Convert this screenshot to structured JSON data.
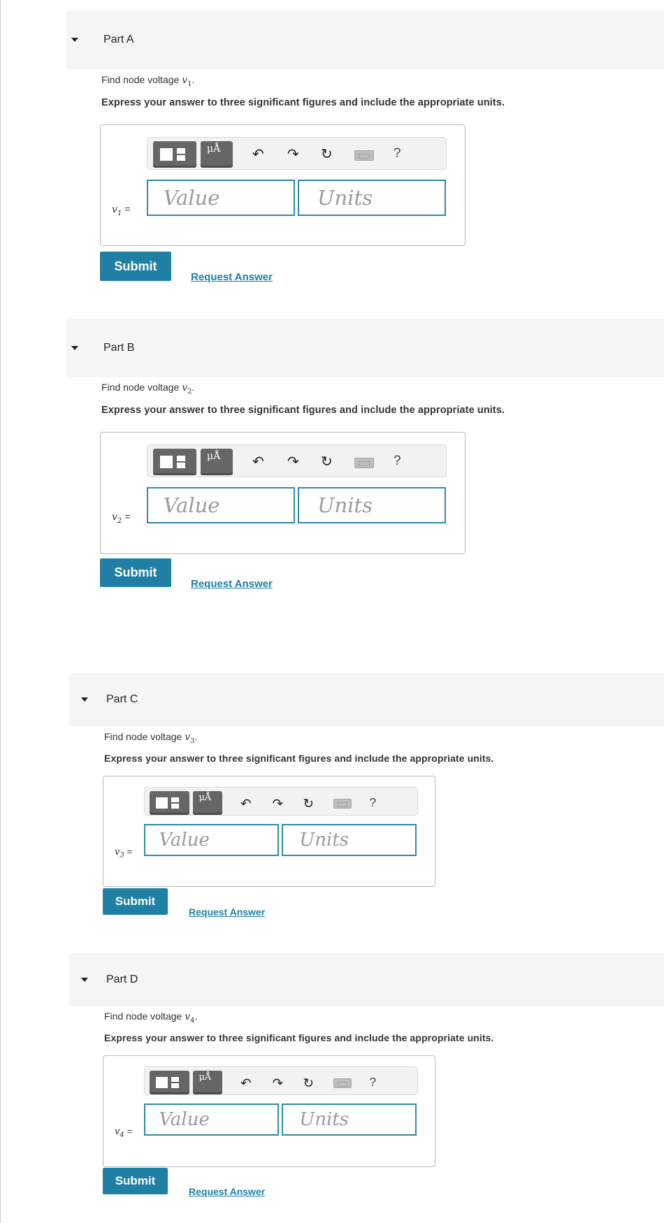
{
  "parts": [
    {
      "title": "Part A",
      "prompt_text": "Find node voltage ",
      "var": "v",
      "sub": "1",
      "instruction": "Express your answer to three significant figures and include the appropriate units.",
      "equals": "=",
      "value_placeholder": "Value",
      "units_placeholder": "Units",
      "submit_label": "Submit",
      "request_label": "Request Answer",
      "unit_glyph": "μÅ",
      "help": "?"
    },
    {
      "title": "Part B",
      "prompt_text": "Find node voltage ",
      "var": "v",
      "sub": "2",
      "instruction": "Express your answer to three significant figures and include the appropriate units.",
      "equals": "=",
      "value_placeholder": "Value",
      "units_placeholder": "Units",
      "submit_label": "Submit",
      "request_label": "Request Answer",
      "unit_glyph": "μÅ",
      "help": "?"
    },
    {
      "title": "Part C",
      "prompt_text": "Find node voltage ",
      "var": "v",
      "sub": "3",
      "instruction": "Express your answer to three significant figures and include the appropriate units.",
      "equals": "=",
      "value_placeholder": "Value",
      "units_placeholder": "Units",
      "submit_label": "Submit",
      "request_label": "Request Answer",
      "unit_glyph": "μÅ",
      "help": "?"
    },
    {
      "title": "Part D",
      "prompt_text": "Find node voltage ",
      "var": "v",
      "sub": "4",
      "instruction": "Express your answer to three significant figures and include the appropriate units.",
      "equals": "=",
      "value_placeholder": "Value",
      "units_placeholder": "Units",
      "submit_label": "Submit",
      "request_label": "Request Answer",
      "unit_glyph": "μÅ",
      "help": "?"
    }
  ],
  "icons": {
    "undo": "undo-icon",
    "redo": "redo-icon",
    "reset": "reset-icon",
    "keyboard": "keyboard-icon",
    "help": "help-icon",
    "templates": "templates-icon",
    "units": "units-icon"
  },
  "colors": {
    "accent": "#1f7fa5",
    "field_border": "#2e8aa6",
    "header_bg": "#f5f5f5"
  }
}
